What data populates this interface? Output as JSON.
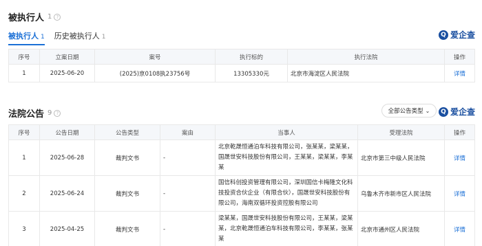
{
  "executed": {
    "title": "被执行人",
    "count": "1",
    "tabs": [
      {
        "label": "被执行人",
        "count": "1"
      },
      {
        "label": "历史被执行人",
        "count": "1"
      }
    ],
    "logo": "爱企查",
    "columns": [
      "序号",
      "立案日期",
      "案号",
      "执行标的",
      "执行法院",
      "操作"
    ],
    "rows": [
      {
        "no": "1",
        "date": "2025-06-20",
        "case": "(2025)京0108执23756号",
        "amount": "13305330元",
        "court": "北京市海淀区人民法院",
        "action": "详情"
      }
    ]
  },
  "notices": {
    "title": "法院公告",
    "count": "9",
    "filter": "全部公告类型",
    "logo": "爱企查",
    "columns": [
      "序号",
      "公告日期",
      "公告类型",
      "案由",
      "当事人",
      "受理法院",
      "操作"
    ],
    "rows": [
      {
        "no": "1",
        "date": "2025-06-28",
        "type": "裁判文书",
        "cause": "-",
        "parties": "北京乾晟恒通泊车科技有限公司，张某某，梁某某，国晟世安科技股份有限公司，王某某，梁某某，李某某",
        "court": "北京市第三中级人民法院",
        "action": "详情"
      },
      {
        "no": "2",
        "date": "2025-06-24",
        "type": "裁判文书",
        "cause": "-",
        "parties": "国信科创投资管理有限公司，深圳国信卡梅隆文化科技投资合伙企业（有限合伙），国晟世安科技股份有限公司，海南双循环投资控股有限公司",
        "court": "乌鲁木齐市新市区人民法院",
        "action": "详情"
      },
      {
        "no": "3",
        "date": "2025-04-25",
        "type": "裁判文书",
        "cause": "-",
        "parties": "梁某某，国晟世安科技股份有限公司，王某某，梁某某，北京乾晟恒通泊车科技有限公司，李某某，张某某",
        "court": "北京市通州区人民法院",
        "action": "详情"
      }
    ]
  }
}
